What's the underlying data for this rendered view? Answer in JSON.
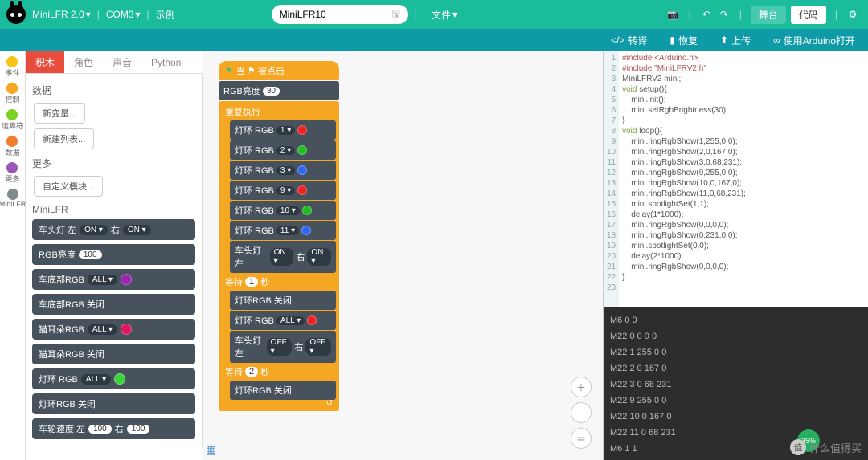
{
  "topbar": {
    "product": "MiniLFR 2.0",
    "port": "COM3",
    "example": "示例",
    "project_name": "MiniLFR10",
    "file": "文件",
    "stage": "舞台",
    "code": "代码"
  },
  "secondbar": {
    "translate": "转译",
    "restore": "恢复",
    "upload": "上传",
    "arduino": "使用Arduino打开"
  },
  "categories": [
    {
      "label": "事件",
      "color": "#f5c518"
    },
    {
      "label": "控制",
      "color": "#f5a623"
    },
    {
      "label": "运算符",
      "color": "#7ed321"
    },
    {
      "label": "数据",
      "color": "#f08030"
    },
    {
      "label": "更多",
      "color": "#9b59b6"
    },
    {
      "label": "MiniLFR",
      "color": "#7f8c8d"
    }
  ],
  "tabs": [
    "积木",
    "角色",
    "声音",
    "Python"
  ],
  "panel": {
    "data": "数据",
    "new_var": "新变量...",
    "new_list": "新建列表...",
    "more": "更多",
    "custom_block": "自定义模块...",
    "minilfr": "MiniLFR"
  },
  "palette": {
    "headlight": {
      "t": "车头灯 左",
      "v1": "ON ▾",
      "m": "右",
      "v2": "ON ▾"
    },
    "brightness": {
      "t": "RGB亮度",
      "v": "100"
    },
    "bottom_rgb": {
      "t": "车底部RGB",
      "d": "ALL ▾",
      "c": "#9b27b0"
    },
    "bottom_off": "车底部RGB 关闭",
    "ear_rgb": {
      "t": "猫耳朵RGB",
      "d": "ALL ▾",
      "c": "#d81b60"
    },
    "ear_off": "猫耳朵RGB 关闭",
    "ring_rgb": {
      "t": "灯环 RGB",
      "d": "ALL ▾",
      "c": "#3bd23b"
    },
    "ring_off": "灯环RGB 关闭",
    "wheel": {
      "t": "车轮速度 左",
      "v1": "100",
      "m": "右",
      "v2": "100"
    }
  },
  "script": {
    "hat": "当 ⚑ 被点击",
    "brightness": {
      "t": "RGB亮度",
      "v": "30"
    },
    "forever": "重复执行",
    "rings": [
      {
        "t": "灯环 RGB",
        "n": "1 ▾",
        "c": "#e22"
      },
      {
        "t": "灯环 RGB",
        "n": "2 ▾",
        "c": "#2b2"
      },
      {
        "t": "灯环 RGB",
        "n": "3 ▾",
        "c": "#36e"
      },
      {
        "t": "灯环 RGB",
        "n": "9 ▾",
        "c": "#e22"
      },
      {
        "t": "灯环 RGB",
        "n": "10 ▾",
        "c": "#2b2"
      },
      {
        "t": "灯环 RGB",
        "n": "11 ▾",
        "c": "#36e"
      }
    ],
    "head_on": {
      "t": "车头灯 左",
      "v1": "ON ▾",
      "m": "右",
      "v2": "ON ▾"
    },
    "wait1": {
      "t": "等待",
      "v": "1",
      "s": "秒"
    },
    "ring_off": "灯环RGB 关闭",
    "ring_all": {
      "t": "灯环 RGB",
      "d": "ALL ▾",
      "c": "#e22"
    },
    "head_off": {
      "t": "车头灯 左",
      "v1": "OFF ▾",
      "m": "右",
      "v2": "OFF ▾"
    },
    "wait2": {
      "t": "等待",
      "v": "2",
      "s": "秒"
    },
    "ring_off2": "灯环RGB 关闭"
  },
  "code_lines": [
    "#include <Arduino.h>",
    "#include \"MiniLFRV2.h\"",
    "MiniLFRV2 mini;",
    "void setup(){",
    "    mini.init();",
    "    mini.setRgbBrightness(30);",
    "}",
    "void loop(){",
    "    mini.ringRgbShow(1,255,0,0);",
    "    mini.ringRgbShow(2,0,167,0);",
    "    mini.ringRgbShow(3,0,68,231);",
    "    mini.ringRgbShow(9,255,0,0);",
    "    mini.ringRgbShow(10,0,167,0);",
    "    mini.ringRgbShow(11,0,68,231);",
    "    mini.spotlightSet(1,1);",
    "    delay(1*1000);",
    "    mini.ringRgbShow(0,0,0,0);",
    "    mini.ringRgbShow(0,231,0,0);",
    "    mini.spotlightSet(0,0);",
    "    delay(2*1000);",
    "    mini.ringRgbShow(0,0,0,0);",
    "}",
    ""
  ],
  "console": [
    "M6 0 0",
    "M22 0 0 0 0",
    "M22 1 255 0 0",
    "M22 2 0 167 0",
    "M22 3 0 68 231",
    "M22 9 255 0 0",
    "M22 10 0 167 0",
    "M22 11 0 68 231",
    "M6 1 1"
  ],
  "badge": "35%",
  "watermark": "什么值得买"
}
